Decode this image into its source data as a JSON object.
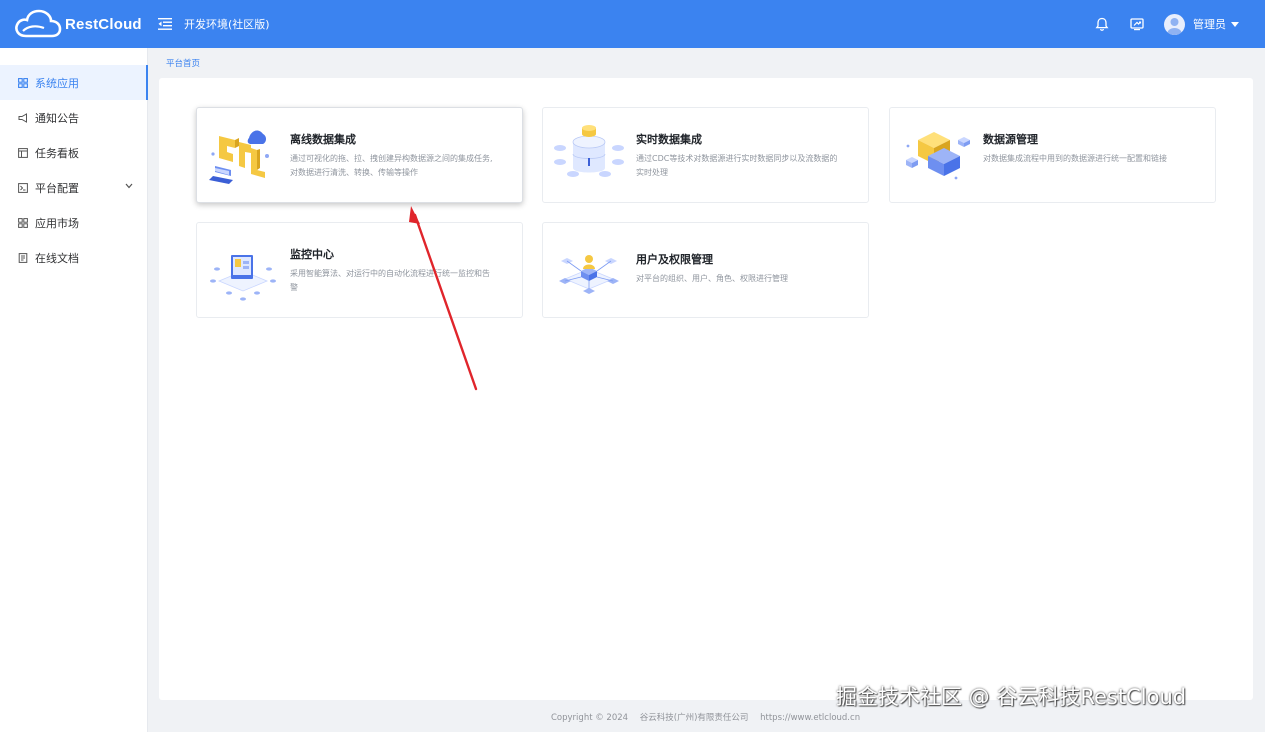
{
  "header": {
    "brand": "RestCloud",
    "environment": "开发环境(社区版)",
    "user_name": "管理员",
    "icons": [
      "menu-fold-icon",
      "bell-icon",
      "screen-share-icon",
      "user-avatar-icon",
      "caret-down-icon"
    ],
    "color": "#3b83f0"
  },
  "sidebar": {
    "items": [
      {
        "label": "系统应用",
        "icon": "grid-icon",
        "active": true
      },
      {
        "label": "通知公告",
        "icon": "megaphone-icon"
      },
      {
        "label": "任务看板",
        "icon": "board-icon"
      },
      {
        "label": "平台配置",
        "icon": "terminal-icon",
        "has_submenu": true
      },
      {
        "label": "应用市场",
        "icon": "apps-icon"
      },
      {
        "label": "在线文档",
        "icon": "document-icon"
      }
    ]
  },
  "breadcrumb": "平台首页",
  "cards": [
    {
      "title": "离线数据集成",
      "desc": "通过可视化的拖、拉、拽创建异构数据源之间的集成任务,对数据进行清洗、转换、传输等操作"
    },
    {
      "title": "实时数据集成",
      "desc": "通过CDC等技术对数据源进行实时数据同步以及流数据的实时处理"
    },
    {
      "title": "数据源管理",
      "desc": "对数据集成流程中用到的数据源进行统一配置和链接"
    },
    {
      "title": "监控中心",
      "desc": "采用智能算法、对运行中的自动化流程进行统一监控和告警"
    },
    {
      "title": "用户及权限管理",
      "desc": "对平台的组织、用户、角色、权限进行管理"
    }
  ],
  "footer": {
    "copyright": "Copyright © 2024",
    "company": "谷云科技(广州)有限责任公司",
    "url": "https://www.etlcloud.cn"
  },
  "watermark": "掘金技术社区 @ 谷云科技RestCloud",
  "annotation_color": "#e0252b"
}
